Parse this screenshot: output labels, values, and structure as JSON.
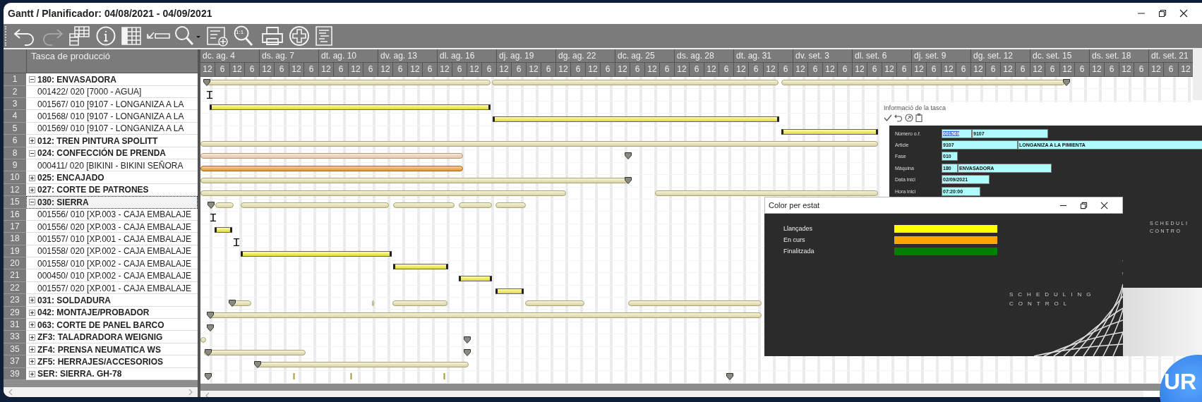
{
  "window": {
    "title": "Gantt / Planificador: 04/08/2021 - 04/09/2021"
  },
  "toolbar": [
    {
      "kind": "undo",
      "disabled": false
    },
    {
      "kind": "redo",
      "disabled": true
    },
    {
      "kind": "grid-stack",
      "disabled": false
    },
    {
      "kind": "info",
      "disabled": false
    },
    {
      "kind": "table",
      "disabled": false
    },
    {
      "kind": "check-minus",
      "disabled": false
    },
    {
      "kind": "zoom-menu",
      "disabled": false
    },
    {
      "kind": "list-add",
      "disabled": false
    },
    {
      "kind": "zoom-fit",
      "label": "1:1",
      "disabled": false
    },
    {
      "kind": "print",
      "disabled": false
    },
    {
      "kind": "add",
      "disabled": false
    },
    {
      "kind": "document",
      "disabled": false
    }
  ],
  "task_column": {
    "header": "Tasca de producció"
  },
  "timescale": [
    {
      "label": "dc. ag. 4",
      "ticks": [
        "12",
        "6",
        "12",
        "6"
      ]
    },
    {
      "label": "ds. ag. 7",
      "ticks": [
        "12",
        "6",
        "12",
        "6"
      ]
    },
    {
      "label": "dt. ag. 10",
      "ticks": [
        "12",
        "6",
        "12",
        "6"
      ]
    },
    {
      "label": "dv. ag. 13",
      "ticks": [
        "12",
        "6",
        "12",
        "6"
      ]
    },
    {
      "label": "dl. ag. 16",
      "ticks": [
        "12",
        "6",
        "12",
        "6"
      ]
    },
    {
      "label": "dj. ag. 19",
      "ticks": [
        "12",
        "6",
        "12",
        "6"
      ]
    },
    {
      "label": "dg. ag. 22",
      "ticks": [
        "12",
        "6",
        "12",
        "6"
      ]
    },
    {
      "label": "dc. ag. 25",
      "ticks": [
        "12",
        "6",
        "12",
        "6"
      ]
    },
    {
      "label": "ds. ag. 28",
      "ticks": [
        "12",
        "6",
        "12",
        "6"
      ]
    },
    {
      "label": "dt. ag. 31",
      "ticks": [
        "12",
        "6",
        "12",
        "6"
      ]
    },
    {
      "label": "dv. set. 3",
      "ticks": [
        "12",
        "6",
        "12",
        "6"
      ]
    },
    {
      "label": "dl. set. 6",
      "ticks": [
        "12",
        "6",
        "12",
        "6"
      ]
    },
    {
      "label": "dj. set. 9",
      "ticks": [
        "12",
        "6",
        "12",
        "6"
      ]
    },
    {
      "label": "dg. set. 12",
      "ticks": [
        "12",
        "6",
        "12",
        "6"
      ]
    },
    {
      "label": "dc. set. 15",
      "ticks": [
        "12",
        "6",
        "12",
        "6"
      ]
    },
    {
      "label": "ds. set. 18",
      "ticks": [
        "12",
        "6",
        "12",
        "6"
      ]
    },
    {
      "label": "dt. set. 21",
      "ticks": [
        "12",
        "6",
        "12"
      ]
    }
  ],
  "tasks": [
    {
      "number": "1",
      "name": "180: ENVASADORA",
      "expanded": true,
      "selected": false,
      "children": [
        {
          "number": "2",
          "name": "001422/ 020 [7000 - AGUA]",
          "selected": false
        },
        {
          "number": "3",
          "name": "001567/ 010 [9107 - LONGANIZA A LA",
          "selected": false
        },
        {
          "number": "4",
          "name": "001568/ 010 [9107 - LONGANIZA A LA",
          "selected": false
        },
        {
          "number": "5",
          "name": "001569/ 010 [9107 - LONGANIZA A LA",
          "selected": false
        }
      ]
    },
    {
      "number": "6",
      "name": "012: TREN PINTURA SPOLITT",
      "expanded": false,
      "selected": false
    },
    {
      "number": "8",
      "name": "024: CONFECCIÓN DE PRENDA",
      "expanded": true,
      "selected": false,
      "children": [
        {
          "number": "9",
          "name": "000411/ 020 [BIKINI - BIKINI SEÑORA",
          "selected": false
        }
      ]
    },
    {
      "number": "10",
      "name": "025: ENCAJADO",
      "expanded": false,
      "selected": false
    },
    {
      "number": "12",
      "name": "027: CORTE DE PATRONES",
      "expanded": false,
      "selected": false
    },
    {
      "number": "15",
      "name": "030: SIERRA",
      "expanded": true,
      "selected": true,
      "children": [
        {
          "number": "16",
          "name": "001556/ 010 [XP.003 - CAJA EMBALAJE",
          "selected": false
        },
        {
          "number": "17",
          "name": "001556/ 020 [XP.003 - CAJA EMBALAJE",
          "selected": false
        },
        {
          "number": "18",
          "name": "001557/ 010 [XP.001 - CAJA EMBALAJE",
          "selected": false
        },
        {
          "number": "19",
          "name": "001558/ 020 [XP.002 - CAJA EMBALAJE",
          "selected": false
        },
        {
          "number": "20",
          "name": "001558/ 010 [XP.002 - CAJA EMBALAJE",
          "selected": false
        },
        {
          "number": "21",
          "name": "000450/ 010 [XP.002 - CAJA EMBALAJE",
          "selected": false
        },
        {
          "number": "22",
          "name": "001557/ 020 [XP.001 - CAJA EMBALAJE",
          "selected": false
        }
      ]
    },
    {
      "number": "23",
      "name": "031: SOLDADURA",
      "expanded": false,
      "selected": false
    },
    {
      "number": "29",
      "name": "042: MONTAJE/PROBADOR",
      "expanded": false,
      "selected": false
    },
    {
      "number": "31",
      "name": "063: CORTE DE PANEL BARCO",
      "expanded": false,
      "selected": false
    },
    {
      "number": "33",
      "name": "ZF3: TALADRADORA WEIGNIG",
      "expanded": false,
      "selected": false
    },
    {
      "number": "35",
      "name": "ZF4: PRENSA NEUMATICA WS",
      "expanded": false,
      "selected": false
    },
    {
      "number": "37",
      "name": "ZF5: HERRAJES/ACCESORIOS",
      "expanded": false,
      "selected": false
    },
    {
      "number": "39",
      "name": "SER: SIERRA. GH-78",
      "expanded": false,
      "selected": false
    }
  ],
  "task_info": {
    "title": "Informació de la tasca",
    "fields": [
      {
        "label": "Número o.f.",
        "values": [
          "001569",
          "9107"
        ]
      },
      {
        "label": "Article",
        "values": [
          "9107",
          "LONGANIZA A LA PIMIENTA"
        ]
      },
      {
        "label": "Fase",
        "values": [
          "010"
        ]
      },
      {
        "label": "Màquina",
        "values": [
          "180",
          "ENVASADORA"
        ]
      },
      {
        "label": "Data inici",
        "values": [
          "02/09/2021"
        ]
      },
      {
        "label": "Hora inici",
        "values": [
          "07:20:00"
        ]
      }
    ]
  },
  "color_dialog": {
    "title": "Color per estat",
    "legend": [
      {
        "label": "Llançades",
        "color": "#ffff00"
      },
      {
        "label": "En curs",
        "color": "#ffa500"
      },
      {
        "label": "Finalitzada",
        "color": "#008000"
      }
    ]
  },
  "brand": {
    "line_1": "SCHEDULING",
    "line_2": "CONTROL",
    "side_line_1": "SCHEDULI",
    "side_line_2": "CONTRO",
    "logo": "UR"
  }
}
